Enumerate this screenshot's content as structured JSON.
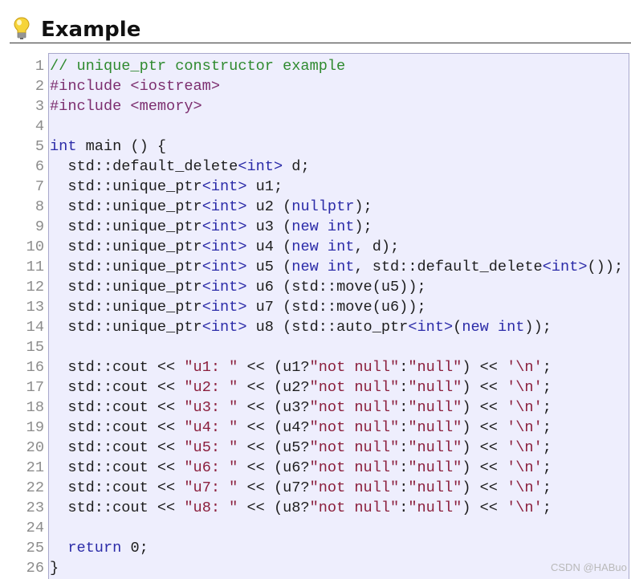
{
  "heading": {
    "title": "Example",
    "icon": "lightbulb-icon"
  },
  "colors": {
    "heading_text": "#111111",
    "heading_rule": "#333333",
    "code_background": "#eeeefd",
    "code_border": "#a8a8cc",
    "line_number": "#8c8c8c",
    "watermark": "#b9b9b9"
  },
  "code": {
    "lines": [
      {
        "number": 1,
        "tokens": [
          {
            "text": "// unique_ptr constructor example",
            "color": "#2f8a2f"
          }
        ]
      },
      {
        "number": 2,
        "tokens": [
          {
            "text": "#include <iostream>",
            "color": "#7c2e6f"
          }
        ]
      },
      {
        "number": 3,
        "tokens": [
          {
            "text": "#include <memory>",
            "color": "#7c2e6f"
          }
        ]
      },
      {
        "number": 4,
        "tokens": []
      },
      {
        "number": 5,
        "tokens": [
          {
            "text": "int",
            "color": "#2b2ba8"
          },
          {
            "text": " main () {",
            "color": "#1e1e1e"
          }
        ]
      },
      {
        "number": 6,
        "tokens": [
          {
            "text": "  std::default_delete",
            "color": "#1e1e1e"
          },
          {
            "text": "<int>",
            "color": "#2b2ba8"
          },
          {
            "text": " d;",
            "color": "#1e1e1e"
          }
        ]
      },
      {
        "number": 7,
        "tokens": [
          {
            "text": "  std::unique_ptr",
            "color": "#1e1e1e"
          },
          {
            "text": "<int>",
            "color": "#2b2ba8"
          },
          {
            "text": " u1;",
            "color": "#1e1e1e"
          }
        ]
      },
      {
        "number": 8,
        "tokens": [
          {
            "text": "  std::unique_ptr",
            "color": "#1e1e1e"
          },
          {
            "text": "<int>",
            "color": "#2b2ba8"
          },
          {
            "text": " u2 (",
            "color": "#1e1e1e"
          },
          {
            "text": "nullptr",
            "color": "#2b2ba8"
          },
          {
            "text": ");",
            "color": "#1e1e1e"
          }
        ]
      },
      {
        "number": 9,
        "tokens": [
          {
            "text": "  std::unique_ptr",
            "color": "#1e1e1e"
          },
          {
            "text": "<int>",
            "color": "#2b2ba8"
          },
          {
            "text": " u3 (",
            "color": "#1e1e1e"
          },
          {
            "text": "new int",
            "color": "#2b2ba8"
          },
          {
            "text": ");",
            "color": "#1e1e1e"
          }
        ]
      },
      {
        "number": 10,
        "tokens": [
          {
            "text": "  std::unique_ptr",
            "color": "#1e1e1e"
          },
          {
            "text": "<int>",
            "color": "#2b2ba8"
          },
          {
            "text": " u4 (",
            "color": "#1e1e1e"
          },
          {
            "text": "new int",
            "color": "#2b2ba8"
          },
          {
            "text": ", d);",
            "color": "#1e1e1e"
          }
        ]
      },
      {
        "number": 11,
        "tokens": [
          {
            "text": "  std::unique_ptr",
            "color": "#1e1e1e"
          },
          {
            "text": "<int>",
            "color": "#2b2ba8"
          },
          {
            "text": " u5 (",
            "color": "#1e1e1e"
          },
          {
            "text": "new int",
            "color": "#2b2ba8"
          },
          {
            "text": ", std::default_delete",
            "color": "#1e1e1e"
          },
          {
            "text": "<int>",
            "color": "#2b2ba8"
          },
          {
            "text": "());",
            "color": "#1e1e1e"
          }
        ]
      },
      {
        "number": 12,
        "tokens": [
          {
            "text": "  std::unique_ptr",
            "color": "#1e1e1e"
          },
          {
            "text": "<int>",
            "color": "#2b2ba8"
          },
          {
            "text": " u6 (std::move(u5));",
            "color": "#1e1e1e"
          }
        ]
      },
      {
        "number": 13,
        "tokens": [
          {
            "text": "  std::unique_ptr",
            "color": "#1e1e1e"
          },
          {
            "text": "<int>",
            "color": "#2b2ba8"
          },
          {
            "text": " u7 (std::move(u6));",
            "color": "#1e1e1e"
          }
        ]
      },
      {
        "number": 14,
        "tokens": [
          {
            "text": "  std::unique_ptr",
            "color": "#1e1e1e"
          },
          {
            "text": "<int>",
            "color": "#2b2ba8"
          },
          {
            "text": " u8 (std::auto_ptr",
            "color": "#1e1e1e"
          },
          {
            "text": "<int>",
            "color": "#2b2ba8"
          },
          {
            "text": "(",
            "color": "#1e1e1e"
          },
          {
            "text": "new int",
            "color": "#2b2ba8"
          },
          {
            "text": "));",
            "color": "#1e1e1e"
          }
        ]
      },
      {
        "number": 15,
        "tokens": []
      },
      {
        "number": 16,
        "tokens": [
          {
            "text": "  std::cout << ",
            "color": "#1e1e1e"
          },
          {
            "text": "\"u1: \"",
            "color": "#8b1f3d"
          },
          {
            "text": " << (u1?",
            "color": "#1e1e1e"
          },
          {
            "text": "\"not null\"",
            "color": "#8b1f3d"
          },
          {
            "text": ":",
            "color": "#1e1e1e"
          },
          {
            "text": "\"null\"",
            "color": "#8b1f3d"
          },
          {
            "text": ") << ",
            "color": "#1e1e1e"
          },
          {
            "text": "'\\n'",
            "color": "#8b1f3d"
          },
          {
            "text": ";",
            "color": "#1e1e1e"
          }
        ]
      },
      {
        "number": 17,
        "tokens": [
          {
            "text": "  std::cout << ",
            "color": "#1e1e1e"
          },
          {
            "text": "\"u2: \"",
            "color": "#8b1f3d"
          },
          {
            "text": " << (u2?",
            "color": "#1e1e1e"
          },
          {
            "text": "\"not null\"",
            "color": "#8b1f3d"
          },
          {
            "text": ":",
            "color": "#1e1e1e"
          },
          {
            "text": "\"null\"",
            "color": "#8b1f3d"
          },
          {
            "text": ") << ",
            "color": "#1e1e1e"
          },
          {
            "text": "'\\n'",
            "color": "#8b1f3d"
          },
          {
            "text": ";",
            "color": "#1e1e1e"
          }
        ]
      },
      {
        "number": 18,
        "tokens": [
          {
            "text": "  std::cout << ",
            "color": "#1e1e1e"
          },
          {
            "text": "\"u3: \"",
            "color": "#8b1f3d"
          },
          {
            "text": " << (u3?",
            "color": "#1e1e1e"
          },
          {
            "text": "\"not null\"",
            "color": "#8b1f3d"
          },
          {
            "text": ":",
            "color": "#1e1e1e"
          },
          {
            "text": "\"null\"",
            "color": "#8b1f3d"
          },
          {
            "text": ") << ",
            "color": "#1e1e1e"
          },
          {
            "text": "'\\n'",
            "color": "#8b1f3d"
          },
          {
            "text": ";",
            "color": "#1e1e1e"
          }
        ]
      },
      {
        "number": 19,
        "tokens": [
          {
            "text": "  std::cout << ",
            "color": "#1e1e1e"
          },
          {
            "text": "\"u4: \"",
            "color": "#8b1f3d"
          },
          {
            "text": " << (u4?",
            "color": "#1e1e1e"
          },
          {
            "text": "\"not null\"",
            "color": "#8b1f3d"
          },
          {
            "text": ":",
            "color": "#1e1e1e"
          },
          {
            "text": "\"null\"",
            "color": "#8b1f3d"
          },
          {
            "text": ") << ",
            "color": "#1e1e1e"
          },
          {
            "text": "'\\n'",
            "color": "#8b1f3d"
          },
          {
            "text": ";",
            "color": "#1e1e1e"
          }
        ]
      },
      {
        "number": 20,
        "tokens": [
          {
            "text": "  std::cout << ",
            "color": "#1e1e1e"
          },
          {
            "text": "\"u5: \"",
            "color": "#8b1f3d"
          },
          {
            "text": " << (u5?",
            "color": "#1e1e1e"
          },
          {
            "text": "\"not null\"",
            "color": "#8b1f3d"
          },
          {
            "text": ":",
            "color": "#1e1e1e"
          },
          {
            "text": "\"null\"",
            "color": "#8b1f3d"
          },
          {
            "text": ") << ",
            "color": "#1e1e1e"
          },
          {
            "text": "'\\n'",
            "color": "#8b1f3d"
          },
          {
            "text": ";",
            "color": "#1e1e1e"
          }
        ]
      },
      {
        "number": 21,
        "tokens": [
          {
            "text": "  std::cout << ",
            "color": "#1e1e1e"
          },
          {
            "text": "\"u6: \"",
            "color": "#8b1f3d"
          },
          {
            "text": " << (u6?",
            "color": "#1e1e1e"
          },
          {
            "text": "\"not null\"",
            "color": "#8b1f3d"
          },
          {
            "text": ":",
            "color": "#1e1e1e"
          },
          {
            "text": "\"null\"",
            "color": "#8b1f3d"
          },
          {
            "text": ") << ",
            "color": "#1e1e1e"
          },
          {
            "text": "'\\n'",
            "color": "#8b1f3d"
          },
          {
            "text": ";",
            "color": "#1e1e1e"
          }
        ]
      },
      {
        "number": 22,
        "tokens": [
          {
            "text": "  std::cout << ",
            "color": "#1e1e1e"
          },
          {
            "text": "\"u7: \"",
            "color": "#8b1f3d"
          },
          {
            "text": " << (u7?",
            "color": "#1e1e1e"
          },
          {
            "text": "\"not null\"",
            "color": "#8b1f3d"
          },
          {
            "text": ":",
            "color": "#1e1e1e"
          },
          {
            "text": "\"null\"",
            "color": "#8b1f3d"
          },
          {
            "text": ") << ",
            "color": "#1e1e1e"
          },
          {
            "text": "'\\n'",
            "color": "#8b1f3d"
          },
          {
            "text": ";",
            "color": "#1e1e1e"
          }
        ]
      },
      {
        "number": 23,
        "tokens": [
          {
            "text": "  std::cout << ",
            "color": "#1e1e1e"
          },
          {
            "text": "\"u8: \"",
            "color": "#8b1f3d"
          },
          {
            "text": " << (u8?",
            "color": "#1e1e1e"
          },
          {
            "text": "\"not null\"",
            "color": "#8b1f3d"
          },
          {
            "text": ":",
            "color": "#1e1e1e"
          },
          {
            "text": "\"null\"",
            "color": "#8b1f3d"
          },
          {
            "text": ") << ",
            "color": "#1e1e1e"
          },
          {
            "text": "'\\n'",
            "color": "#8b1f3d"
          },
          {
            "text": ";",
            "color": "#1e1e1e"
          }
        ]
      },
      {
        "number": 24,
        "tokens": []
      },
      {
        "number": 25,
        "tokens": [
          {
            "text": "  ",
            "color": "#1e1e1e"
          },
          {
            "text": "return",
            "color": "#2b2ba8"
          },
          {
            "text": " 0;",
            "color": "#1e1e1e"
          }
        ]
      },
      {
        "number": 26,
        "tokens": [
          {
            "text": "}",
            "color": "#1e1e1e"
          }
        ]
      }
    ]
  },
  "watermark": "CSDN @HABuo"
}
